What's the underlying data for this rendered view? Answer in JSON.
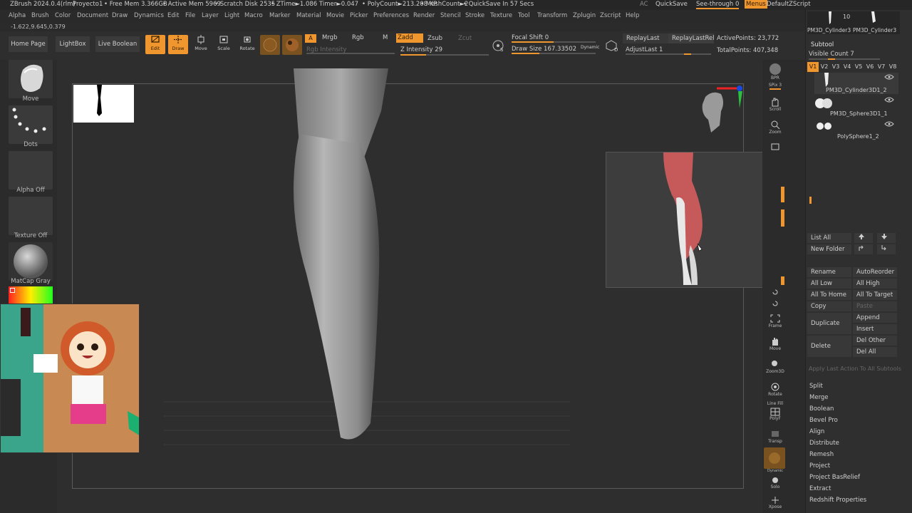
{
  "titlebar": {
    "app": "ZBrush 2024.0.4(rlm)",
    "project": "Proyecto1",
    "free_mem": "• Free Mem 3.366GB",
    "active_mem": "• Active Mem 5969",
    "scratch": "• Scratch Disk 2535",
    "ztime": "• ZTime►1.086 Timer►0.047",
    "polycount": "• PolyCount►213.208 KP",
    "meshcount": "• MeshCount►2",
    "quicksave": "• QuickSave In 57 Secs",
    "ac": "AC",
    "quicksave_btn": "QuickSave",
    "see_through": "See-through 0",
    "menus": "Menus",
    "default_script": "DefaultZScript"
  },
  "menubar": [
    "Alpha",
    "Brush",
    "Color",
    "Document",
    "Draw",
    "Dynamics",
    "Edit",
    "File",
    "Layer",
    "Light",
    "Macro",
    "Marker",
    "Material",
    "Movie",
    "Picker",
    "Preferences",
    "Render",
    "Stencil",
    "Stroke",
    "Texture",
    "Tool",
    "Transform",
    "Zplugin",
    "Zscript",
    "Help"
  ],
  "coords": "-1.622,9.645,0.379",
  "toolbar": {
    "home_page": "Home Page",
    "lightbox": "LightBox",
    "live_boolean": "Live Boolean",
    "edit": "Edit",
    "draw": "Draw",
    "move": "Move",
    "scale": "Scale",
    "rotate": "Rotate",
    "a_label": "A",
    "mrgb": "Mrgb",
    "rgb": "Rgb",
    "m": "M",
    "zadd": "Zadd",
    "zsub": "Zsub",
    "zcut": "Zcut",
    "rgb_intensity": "Rgb Intensity",
    "z_intensity": "Z Intensity 29",
    "focal_shift": "Focal Shift 0",
    "draw_size": "Draw Size 167.33502",
    "dynamic": "Dynamic",
    "s": "S",
    "d": "D",
    "replay_last": "ReplayLast",
    "replay_last_rel": "ReplayLastRel",
    "adjust_last": "AdjustLast 1",
    "active_points": "ActivePoints: 23,772",
    "total_points": "TotalPoints: 407,348",
    "z_intensity_level": 0.29,
    "focal_shift_level": 0.5,
    "draw_size_level": 0.33
  },
  "leftshelf": {
    "brush": "Move",
    "stroke": "Dots",
    "alpha": "Alpha Off",
    "texture": "Texture Off",
    "material": "MatCap Gray"
  },
  "rightshelf": {
    "bpr": "BPR",
    "spix": "SPix 3",
    "scroll": "Scroll",
    "zoom": "Zoom",
    "frame": "Frame",
    "move": "Move",
    "zoom3d": "Zoom3D",
    "rotate": "Rotate",
    "polyf_top": "Line Fill",
    "polyf": "PolyF",
    "transp": "Transp",
    "dynamic": "Dynamic",
    "solo": "Solo",
    "xpose": "Xpose"
  },
  "panel": {
    "tool_count": "10",
    "tool_thumbs": [
      "PM3D_Cylinder3",
      "PM3D_Cylinder3"
    ],
    "subtool_title": "Subtool",
    "visible_count": "Visible Count 7",
    "versions": [
      "V1",
      "V2",
      "V3",
      "V4",
      "V5",
      "V6",
      "V7",
      "V8"
    ],
    "subtools": [
      "PM3D_Cylinder3D1_2",
      "PM3D_Sphere3D1_1",
      "PolySphere1_2"
    ],
    "list_all": "List All",
    "new_folder": "New Folder",
    "rename": "Rename",
    "auto_reorder": "AutoReorder",
    "all_low": "All Low",
    "all_high": "All High",
    "all_to_home": "All To Home",
    "all_to_target": "All To Target",
    "copy": "Copy",
    "paste": "Paste",
    "duplicate": "Duplicate",
    "append": "Append",
    "insert": "Insert",
    "delete": "Delete",
    "del_other": "Del Other",
    "del_all": "Del All",
    "apply_last": "Apply Last Action To All Subtools",
    "actions": [
      "Split",
      "Merge",
      "Boolean",
      "Bevel Pro",
      "Align",
      "Distribute",
      "Remesh",
      "Project",
      "Project BasRelief",
      "Extract",
      "Redshift Properties"
    ]
  },
  "colors": {
    "accent": "#f0962e",
    "red_muscle": "#c65a5a",
    "bone": "#e8e8e8"
  }
}
